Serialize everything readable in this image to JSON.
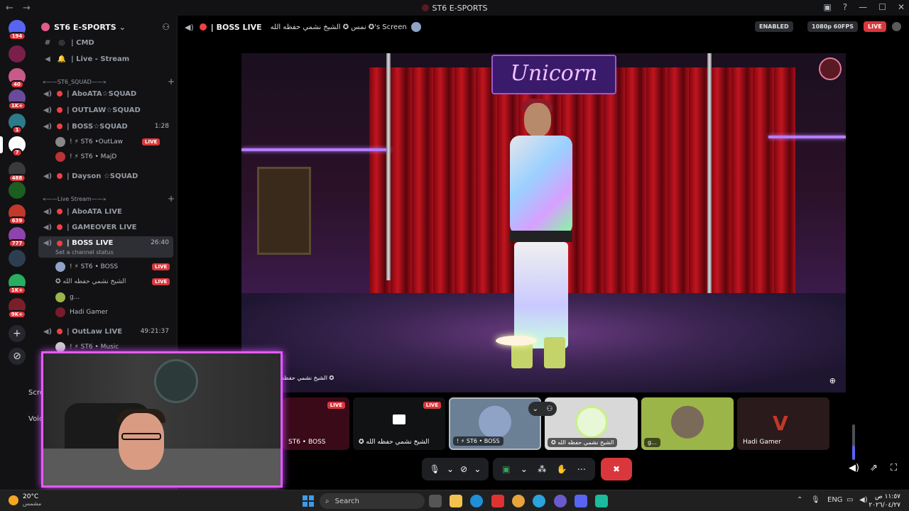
{
  "window": {
    "title": "ST6 E-SPORTS"
  },
  "servers": [
    {
      "badge": "194",
      "color": "#5865f2"
    },
    {
      "badge": "",
      "color": "#7a1f4a"
    },
    {
      "badge": "40",
      "color": "#c85a8a"
    },
    {
      "badge": "1K+",
      "color": "#6a4a9a"
    },
    {
      "badge": "1",
      "color": "#2d7a8a"
    },
    {
      "badge": "7",
      "color": "#ffffff"
    },
    {
      "badge": "488",
      "color": "#3a3a3a"
    },
    {
      "badge": "",
      "color": "#1b5e20"
    },
    {
      "badge": "639",
      "color": "#c0392b"
    },
    {
      "badge": "777",
      "color": "#8e44ad"
    },
    {
      "badge": "",
      "color": "#2c3e50"
    },
    {
      "badge": "1K+",
      "color": "#27ae60"
    },
    {
      "badge": "9K+",
      "color": "#7a1f2a"
    }
  ],
  "sidebar": {
    "guild_name": "ST6 E-SPORTS",
    "channels_top": [
      {
        "icon": "#",
        "name": "| CMD"
      },
      {
        "icon": "🔊",
        "name": "| Live - Stream"
      }
    ],
    "category_squad": "«——ST6_SQUAD——»",
    "squad_channels": [
      {
        "name": "| AboATA☆SQUAD",
        "time": ""
      },
      {
        "name": "| OUTLAW☆SQUAD",
        "time": ""
      },
      {
        "name": "| BOSS☆SQUAD",
        "time": "1:28"
      }
    ],
    "squad_members": [
      {
        "name": "! ⚡ ST6 •OutLaw",
        "live": "LIVE"
      },
      {
        "name": "! ⚡ ST6 • MajD",
        "live": ""
      }
    ],
    "dayson": "| Dayson ☆SQUAD",
    "category_live": "«——Live Stream——»",
    "live_channels": [
      {
        "name": "| AboATA LIVE",
        "time": ""
      },
      {
        "name": "| GAMEOVER LIVE",
        "time": ""
      },
      {
        "name": "| BOSS LIVE",
        "time": "26:40"
      }
    ],
    "channel_status": "Set a channel status",
    "boss_members": [
      {
        "name": "! ⚡ ST6 • BOSS",
        "live": "LIVE"
      },
      {
        "name": "✪ الشيخ نشمي حفظه الله",
        "live": "LIVE"
      },
      {
        "name": "g...",
        "live": ""
      },
      {
        "name": "Hadi Gamer",
        "live": ""
      }
    ],
    "outlaw_live": {
      "name": "| OutLaw LIVE",
      "time": "49:21:37"
    },
    "outlaw_member": "! ⚡ ST6 • Music",
    "panel": {
      "scr": "Scre",
      "voice": "Voic"
    }
  },
  "header": {
    "channel": "| BOSS LIVE",
    "screen_label": "نمس ✪ الشيخ نشمي حفظه الله ✪'s Screen",
    "enabled": "ENABLED",
    "quality": "1080p 60FPS",
    "live": "LIVE"
  },
  "stream": {
    "sign_text": "Unicorn",
    "caption": "الشيخ نشمي حفظه ✪"
  },
  "thumbnails": [
    {
      "label": "ST6 • BOSS",
      "live": "LIVE",
      "bg": "#3a0a18"
    },
    {
      "label": "✪ الشيخ نشمي حفظه الله",
      "live": "LIVE",
      "bg": "#111214"
    },
    {
      "label": "! ⚡ ST6 • BOSS",
      "live": "",
      "bg": "#6b7f95"
    },
    {
      "label": "✪ الشيخ نشمي حفظه الله",
      "live": "",
      "bg": "#d8d8d8"
    },
    {
      "label": "g...",
      "live": "",
      "bg": "#9cb548"
    },
    {
      "label": "Hadi Gamer",
      "live": "",
      "bg": "#2a1a1c"
    }
  ],
  "taskbar": {
    "temp": "20°C",
    "weather": "مشمس",
    "search_placeholder": "Search",
    "lang": "ENG",
    "time": "١١:٥٧ ص",
    "date": "٢٠٢٦/٠٤/٢٧"
  }
}
